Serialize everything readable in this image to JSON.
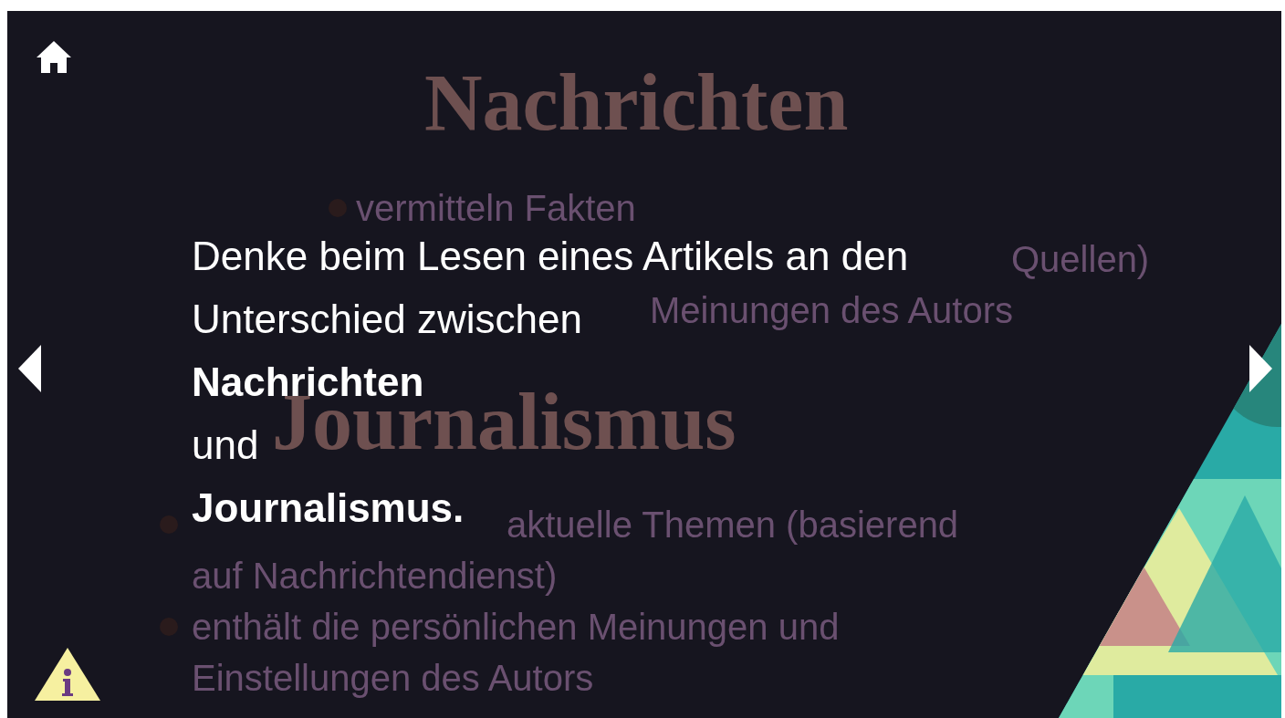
{
  "slide": {
    "rows": [
      {
        "kind": "heading",
        "text": "Nachrichten"
      },
      {
        "kind": "bullet",
        "text": "vermitteln Fakten"
      },
      {
        "kind": "fragment",
        "text": "Quellen)"
      },
      {
        "kind": "fragment",
        "text": "Meinungen des Autors"
      },
      {
        "kind": "heading",
        "text": "Journalismus"
      },
      {
        "kind": "bullet-fragment",
        "text": "aktuelle Themen (basierend"
      },
      {
        "kind": "continuation",
        "text": "auf Nachrichtendienst)"
      },
      {
        "kind": "bullet",
        "text": "enthält die persönlichen Meinungen und"
      },
      {
        "kind": "continuation",
        "text": "Einstellungen des Autors"
      }
    ]
  },
  "overlay": {
    "lines": [
      {
        "kind": "plain",
        "text": "Denke beim Lesen eines Artikels an den"
      },
      {
        "kind": "plain",
        "text": "Unterschied zwischen"
      },
      {
        "kind": "emphasis",
        "text": "Nachrichten"
      },
      {
        "kind": "plain",
        "text": "und"
      },
      {
        "kind": "emphasis",
        "text": "Journalismus."
      }
    ]
  }
}
